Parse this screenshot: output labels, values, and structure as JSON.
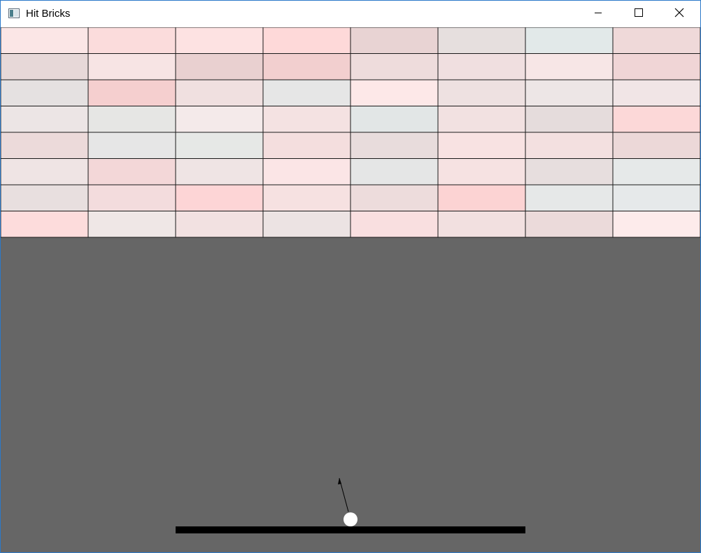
{
  "window": {
    "title": "Hit Bricks",
    "controls": {
      "minimize": "minimize-icon",
      "maximize": "maximize-icon",
      "close": "close-icon"
    },
    "icon": "app-icon"
  },
  "game": {
    "background_color": "#666666",
    "brick_columns": 8,
    "brick_rows": 8,
    "brick_colors": [
      [
        "#fbe6e6",
        "#fbdcdc",
        "#fde2e2",
        "#fed9d9",
        "#e8d3d3",
        "#e6dfde",
        "#e2e9e9",
        "#efd9d9"
      ],
      [
        "#e7d8d8",
        "#f7e4e4",
        "#e9d0d0",
        "#f2cfcf",
        "#eedcdc",
        "#f0dfe0",
        "#f7e6e6",
        "#f0d5d6"
      ],
      [
        "#e5e1e1",
        "#f5cfcf",
        "#f0e0e0",
        "#e6e6e6",
        "#fde8e8",
        "#eee1e1",
        "#ede6e6",
        "#f1e5e6"
      ],
      [
        "#ece5e5",
        "#e6e6e4",
        "#f4eaea",
        "#f4e2e2",
        "#e2e6e6",
        "#f2e1e1",
        "#e5dcdc",
        "#fcd8d8"
      ],
      [
        "#ecdada",
        "#e6e6e6",
        "#e6e8e6",
        "#f4dede",
        "#e8dcdc",
        "#f8e2e2",
        "#f3e0e0",
        "#ecd8d8"
      ],
      [
        "#efe4e4",
        "#f3d7d8",
        "#efe4e4",
        "#fbe5e6",
        "#e5e6e6",
        "#f6e2e2",
        "#e7dede",
        "#e6e9e9"
      ],
      [
        "#e8dfdf",
        "#f3dcdd",
        "#fdd5d6",
        "#f6e1e1",
        "#eddcdc",
        "#fcd3d3",
        "#e6e8e8",
        "#e6e9ea"
      ],
      [
        "#fddcdc",
        "#efe7e6",
        "#f2e1e1",
        "#ece3e3",
        "#f9dfe0",
        "#f2e0e0",
        "#ebdada",
        "#fdebeb"
      ]
    ],
    "paddle_color": "#000000",
    "ball_color": "#ffffff",
    "aim_arrow_color": "#000000"
  }
}
